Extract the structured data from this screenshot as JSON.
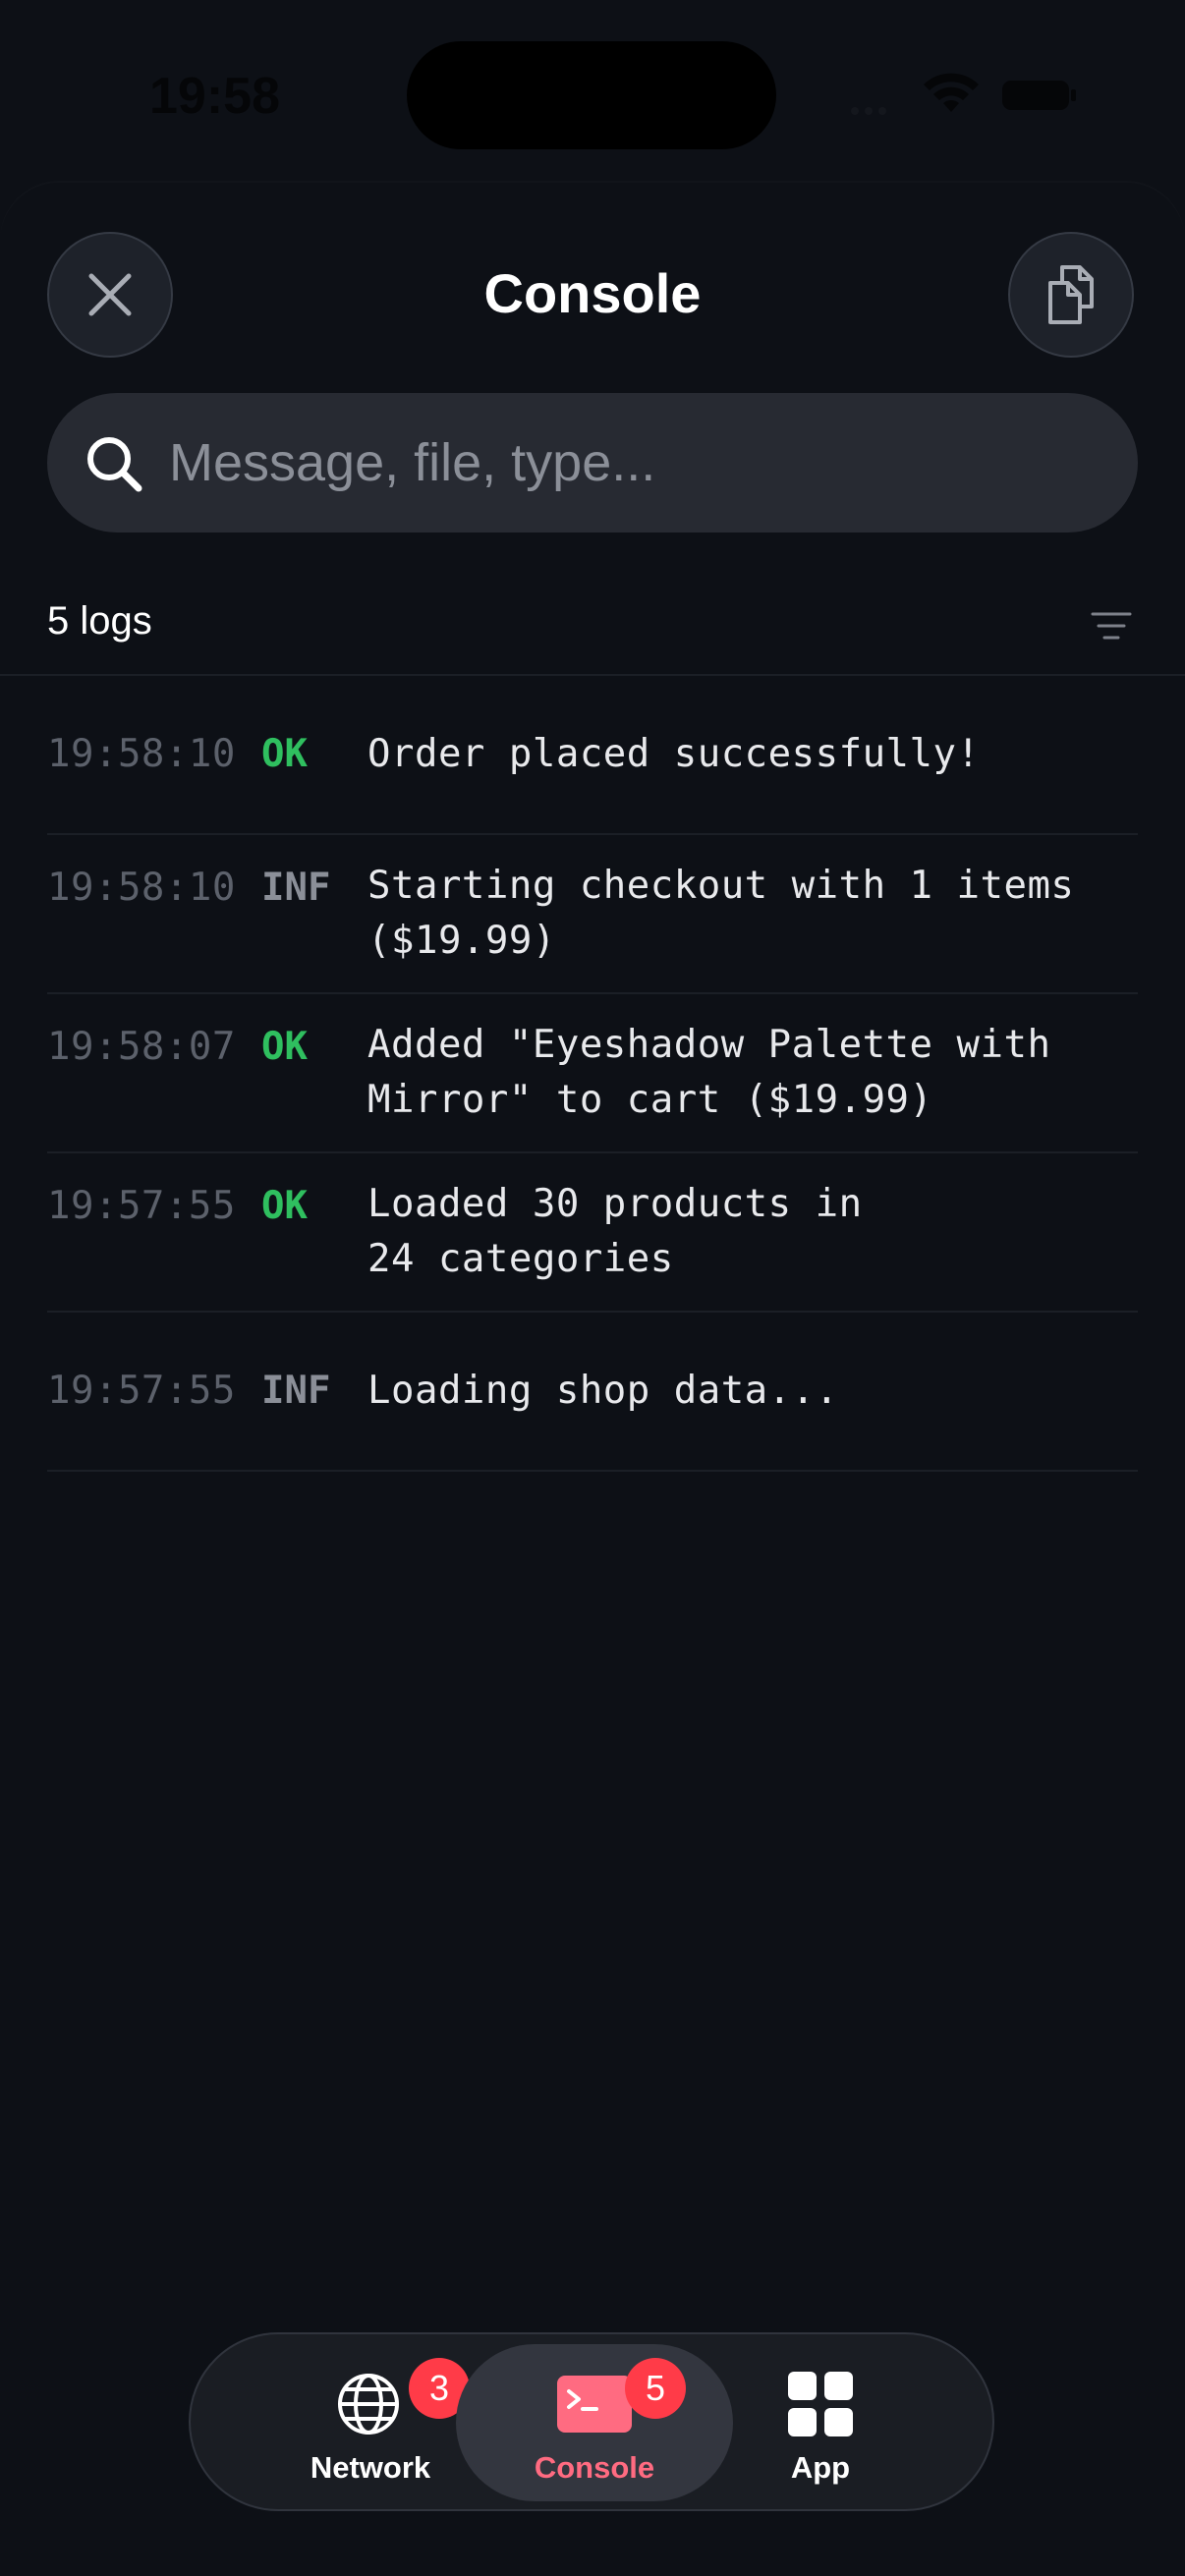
{
  "status_bar": {
    "time": "19:58"
  },
  "header": {
    "title": "Console"
  },
  "search": {
    "placeholder": "Message, file, type..."
  },
  "log_count": "5 logs",
  "logs": [
    {
      "time": "19:58:10",
      "level": "OK",
      "message": "Order placed successfully!"
    },
    {
      "time": "19:58:10",
      "level": "INF",
      "message": "Starting checkout with 1 items\n($19.99)"
    },
    {
      "time": "19:58:07",
      "level": "OK",
      "message": "Added \"Eyeshadow Palette with\nMirror\" to cart ($19.99)"
    },
    {
      "time": "19:57:55",
      "level": "OK",
      "message": "Loaded 30 products in\n24 categories"
    },
    {
      "time": "19:57:55",
      "level": "INF",
      "message": "Loading shop data..."
    }
  ],
  "tabbar": {
    "tabs": [
      {
        "label": "Network",
        "badge": "3",
        "icon": "globe-icon",
        "active": false
      },
      {
        "label": "Console",
        "badge": "5",
        "icon": "terminal-icon",
        "active": true
      },
      {
        "label": "App",
        "icon": "grid-icon",
        "active": false
      }
    ]
  },
  "colors": {
    "background": "#0d1016",
    "ok": "#2fbf5f",
    "info": "#8b8f98",
    "accent": "#ff6b81",
    "badge": "#ff3b48"
  }
}
